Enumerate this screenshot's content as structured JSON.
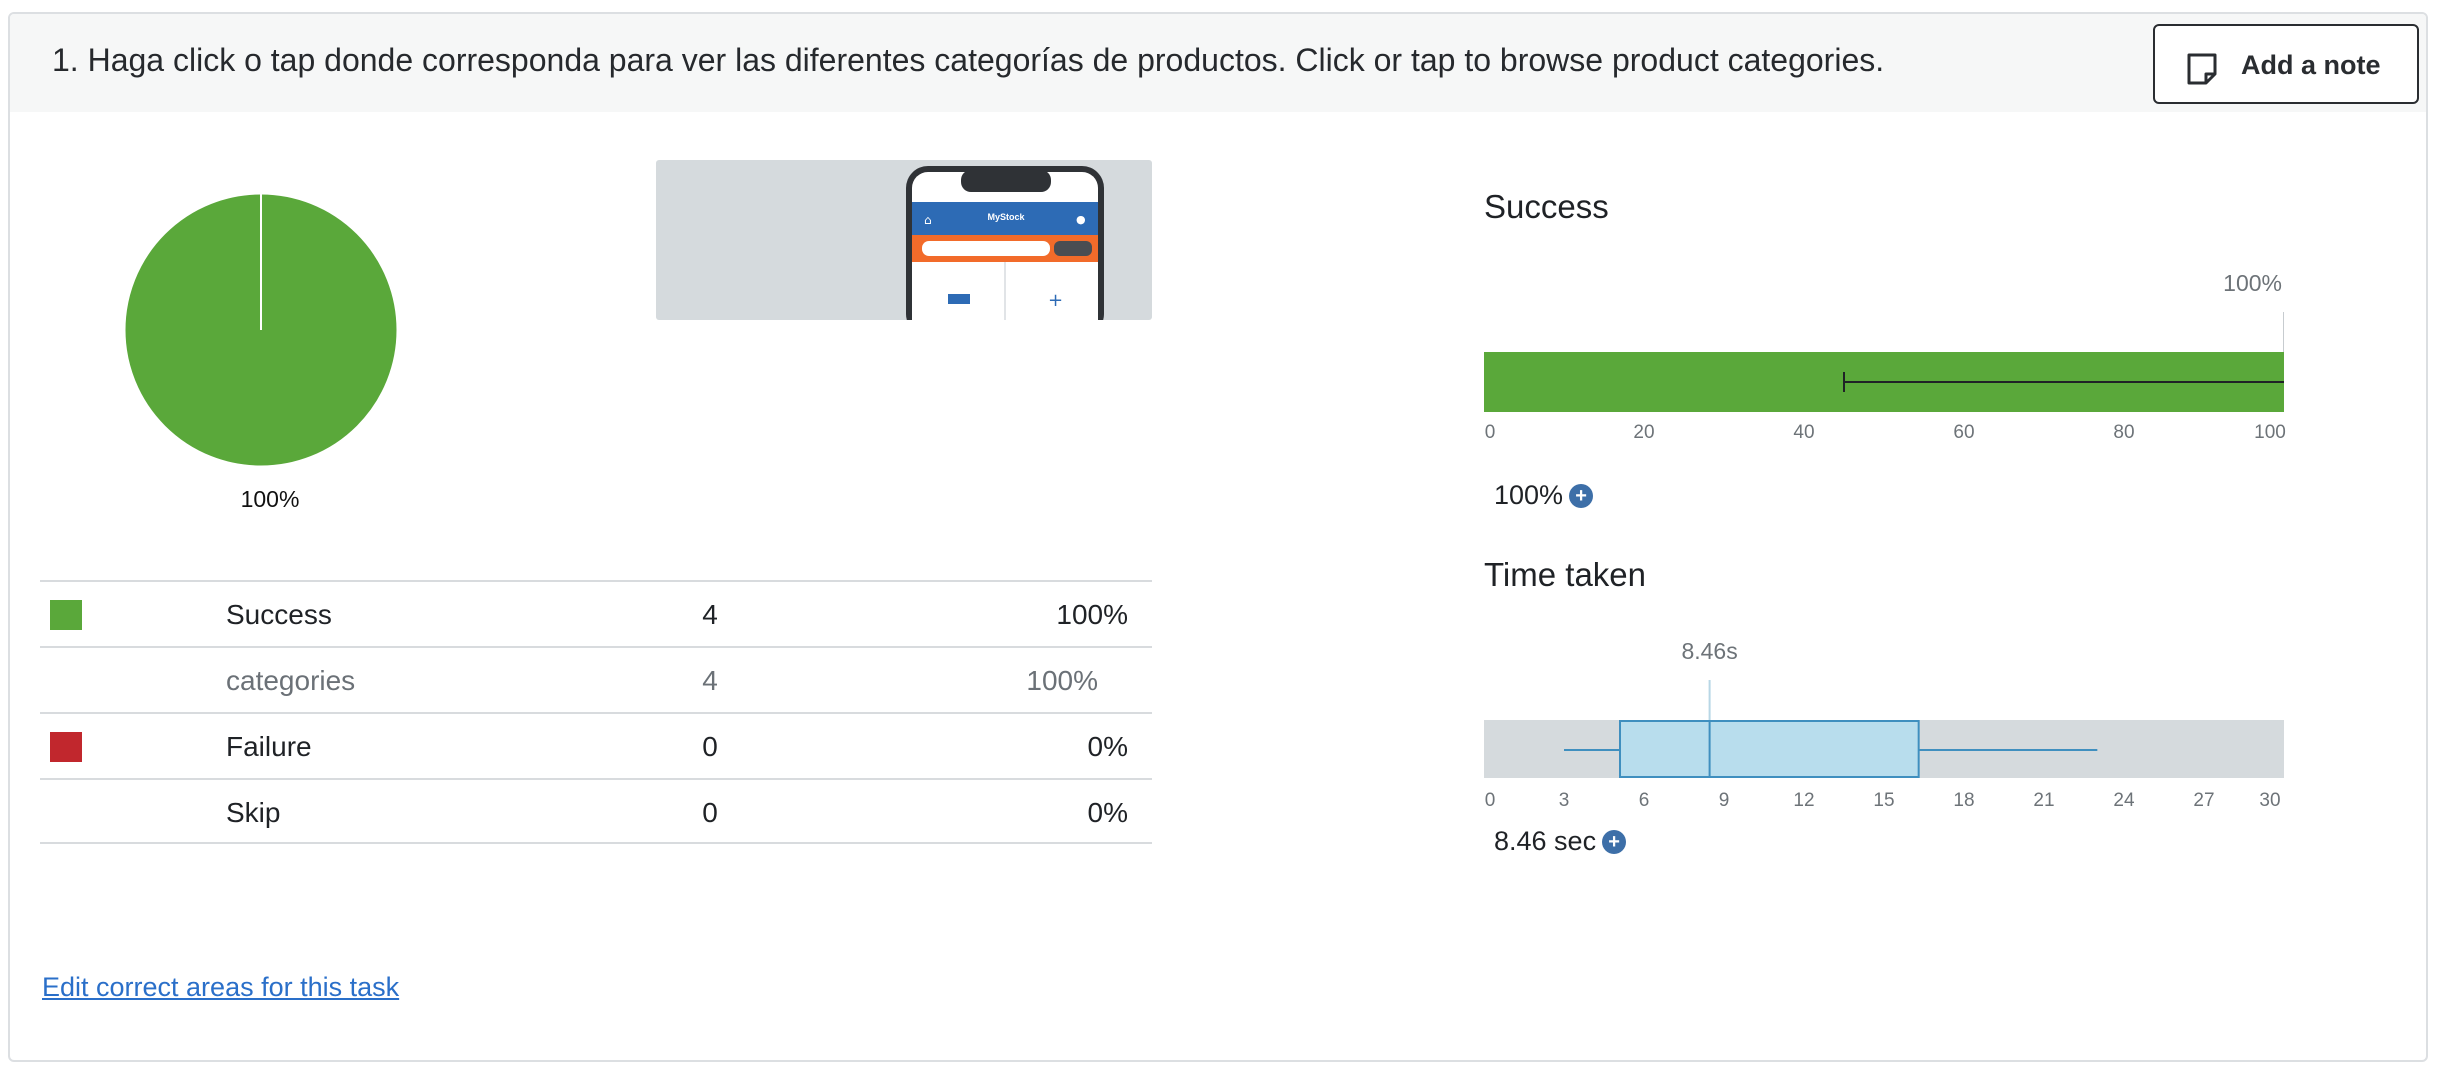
{
  "task": {
    "title": "1. Haga click o tap donde corresponda para ver las diferentes categorías de productos. Click or tap to browse product categories.",
    "add_note_label": "Add a note"
  },
  "pie": {
    "success_fraction": 1.0,
    "label": "100%",
    "success_color": "#5aa83a"
  },
  "thumbnail": {
    "app_title": "MyStock"
  },
  "results": [
    {
      "label": "Success",
      "count": "4",
      "percent": "100%",
      "color": "#5aa83a",
      "sub": false
    },
    {
      "label": "categories",
      "count": "4",
      "percent": "100%",
      "color": null,
      "sub": true
    },
    {
      "label": "Failure",
      "count": "0",
      "percent": "0%",
      "color": "#c1272d",
      "sub": false
    },
    {
      "label": "Skip",
      "count": "0",
      "percent": "0%",
      "color": null,
      "sub": false
    }
  ],
  "edit_link": "Edit correct areas for this task",
  "success_chart": {
    "title": "Success",
    "value_percent": 100,
    "top_label": "100%",
    "error_bar_low": 45,
    "error_bar_high": 100,
    "ticks": [
      "0",
      "20",
      "40",
      "60",
      "80",
      "100"
    ],
    "summary": "100%",
    "xlim": [
      0,
      100
    ]
  },
  "time_chart": {
    "title": "Time taken",
    "median_label": "8.46s",
    "summary": "8.46 sec",
    "ticks": [
      "0",
      "3",
      "6",
      "9",
      "12",
      "15",
      "18",
      "21",
      "24",
      "27",
      "30"
    ],
    "xlim": [
      0,
      30
    ],
    "whisker_low": 3,
    "q1": 5.1,
    "median": 8.46,
    "q3": 16.3,
    "whisker_high": 23
  },
  "chart_data": [
    {
      "type": "pie",
      "slices": [
        {
          "label": "Success",
          "value": 100
        },
        {
          "label": "Failure",
          "value": 0
        }
      ],
      "data_labels": [
        "100%"
      ]
    },
    {
      "type": "bar",
      "title": "Success",
      "categories": [
        "Success"
      ],
      "values": [
        100
      ],
      "xlim": [
        0,
        100
      ],
      "data_labels": [
        "100%"
      ]
    },
    {
      "type": "box",
      "title": "Time taken",
      "xlim": [
        0,
        30
      ],
      "whisker_low": 3,
      "q1": 5.1,
      "median": 8.46,
      "q3": 16.3,
      "whisker_high": 23,
      "data_labels": [
        "8.46s"
      ]
    }
  ]
}
